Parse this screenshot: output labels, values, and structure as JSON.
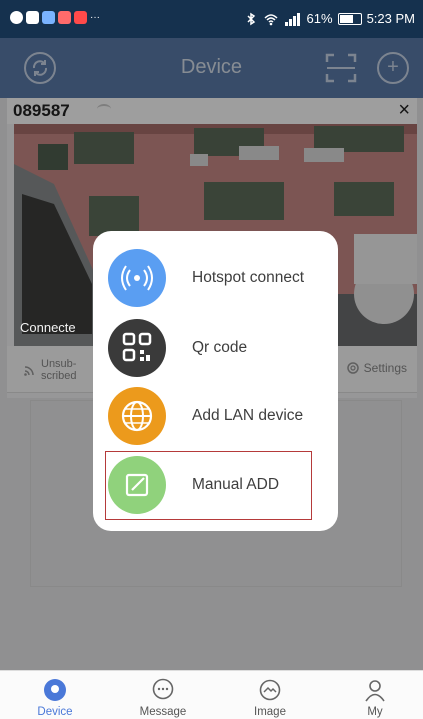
{
  "status_bar": {
    "battery": "61%",
    "time": "5:23 PM",
    "notification_icons": [
      "chat-icon",
      "mail-icon",
      "message-icon",
      "app-icon",
      "news-icon",
      "more-icon"
    ]
  },
  "header": {
    "title": "Device",
    "left_icon": "refresh-icon",
    "right_icons": [
      "scan-icon",
      "add-icon"
    ]
  },
  "device_card": {
    "id": "089587",
    "preview_status": "Connecte",
    "unsubscribed_line1": "Unsub-",
    "unsubscribed_line2": "scribed",
    "settings_label": "Settings",
    "close_glyph": "×"
  },
  "add_menu": {
    "items": [
      {
        "label": "Hotspot connect",
        "icon": "hotspot-icon",
        "color": "#5a9ef2"
      },
      {
        "label": "Qr code",
        "icon": "qr-code-icon",
        "color": "#3a3a3a"
      },
      {
        "label": "Add LAN device",
        "icon": "globe-icon",
        "color": "#ec9a1c"
      },
      {
        "label": "Manual ADD",
        "icon": "edit-icon",
        "color": "#90d27c"
      }
    ],
    "highlighted": "Manual ADD"
  },
  "bottom_nav": {
    "items": [
      {
        "label": "Device",
        "icon": "device-icon",
        "active": true
      },
      {
        "label": "Message",
        "icon": "message-icon",
        "active": false
      },
      {
        "label": "Image",
        "icon": "image-icon",
        "active": false
      },
      {
        "label": "My",
        "icon": "user-icon",
        "active": false
      }
    ],
    "active_color": "#4a78d8"
  }
}
